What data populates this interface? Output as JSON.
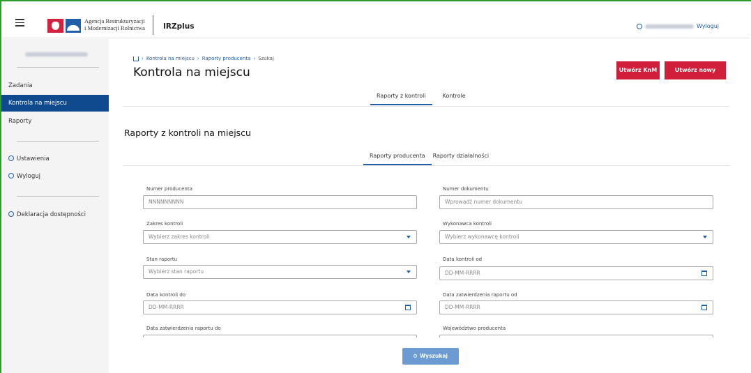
{
  "header": {
    "agency_line1": "Agencja Restrukturyzacji",
    "agency_line2": "i Modernizacji Rolnictwa",
    "app_name": "IRZplus",
    "logout": "Wyloguj"
  },
  "sidebar": {
    "items": [
      {
        "label": "Zadania"
      },
      {
        "label": "Kontrola na miejscu"
      },
      {
        "label": "Raporty"
      },
      {
        "label": "Ustawienia"
      },
      {
        "label": "Wyloguj"
      },
      {
        "label": "Deklaracja dostępności"
      }
    ]
  },
  "breadcrumb": [
    "Kontrola na miejscu",
    "Raporty producenta",
    "Szukaj"
  ],
  "page_title": "Kontrola na miejscu",
  "buttons": {
    "create_knm": "Utwórz KnM",
    "create_report": "Utwórz nowy raport",
    "search": "Wyszukaj"
  },
  "main_tabs": [
    "Raporty z kontroli",
    "Kontrole"
  ],
  "section_title": "Raporty z kontroli na miejscu",
  "sub_tabs": [
    "Raporty producenta",
    "Raporty działalności"
  ],
  "form": {
    "producer_number_label": "Numer producenta",
    "producer_number_placeholder": "NNNNNNNNN",
    "document_number_label": "Numer dokumentu",
    "document_number_placeholder": "Wprowadź numer dokumentu",
    "scope_label": "Zakres kontroli",
    "scope_placeholder": "Wybierz zakres kontroli",
    "executor_label": "Wykonawca kontroli",
    "executor_placeholder": "Wybierz wykonawcę kontroli",
    "state_label": "Stan raportu",
    "state_placeholder": "Wybierz stan raportu",
    "date_from_label": "Data kontroli od",
    "date_placeholder": "DD-MM-RRRR",
    "date_to_label": "Data kontroli do",
    "approval_from_label": "Data zatwierdzenia raportu od",
    "approval_to_label": "Data zatwierdzenia raportu do",
    "voivodeship_label": "Województwo producenta"
  }
}
